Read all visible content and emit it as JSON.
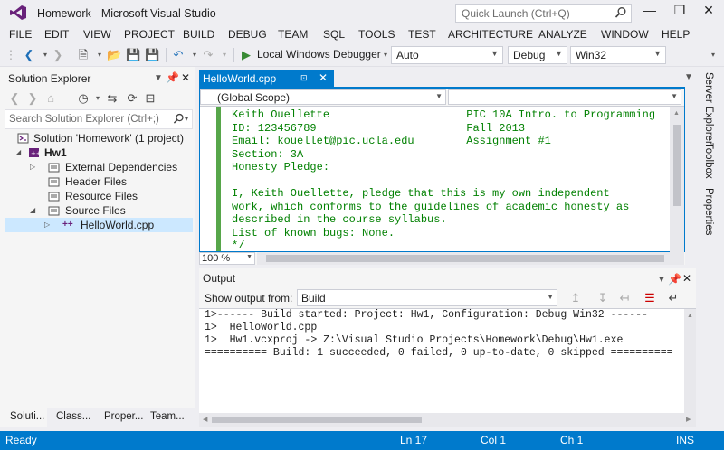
{
  "window": {
    "title": "Homework - Microsoft Visual Studio"
  },
  "quick_launch": {
    "placeholder": "Quick Launch (Ctrl+Q)"
  },
  "menu": [
    "FILE",
    "EDIT",
    "VIEW",
    "PROJECT",
    "BUILD",
    "DEBUG",
    "TEAM",
    "SQL",
    "TOOLS",
    "TEST",
    "ARCHITECTURE",
    "ANALYZE",
    "WINDOW",
    "HELP"
  ],
  "toolbar": {
    "debugger_label": "Local Windows Debugger",
    "config_auto": "Auto",
    "config_mode": "Debug",
    "platform": "Win32"
  },
  "solution_explorer": {
    "title": "Solution Explorer",
    "search_placeholder": "Search Solution Explorer (Ctrl+;)",
    "tree": [
      {
        "label": "Solution 'Homework' (1 project)",
        "icon": "solution-icon"
      },
      {
        "label": "Hw1",
        "icon": "project-icon",
        "bold": true
      },
      {
        "label": "External Dependencies",
        "icon": "folder-icon"
      },
      {
        "label": "Header Files",
        "icon": "folder-icon"
      },
      {
        "label": "Resource Files",
        "icon": "folder-icon"
      },
      {
        "label": "Source Files",
        "icon": "folder-icon"
      },
      {
        "label": "HelloWorld.cpp",
        "icon": "cpp-file-icon",
        "selected": true
      }
    ],
    "bottom_tabs": [
      "Soluti...",
      "Class...",
      "Proper...",
      "Team..."
    ]
  },
  "editor": {
    "tab_label": "HelloWorld.cpp",
    "scope": "(Global Scope)",
    "zoom": "100 %",
    "code_lines": [
      "Keith Ouellette                     PIC 10A Intro. to Programming",
      "ID: 123456789                       Fall 2013",
      "Email: kouellet@pic.ucla.edu        Assignment #1",
      "Section: 3A",
      "Honesty Pledge:",
      "",
      "I, Keith Ouellette, pledge that this is my own independent",
      "work, which conforms to the guidelines of academic honesty as",
      "described in the course syllabus.",
      "List of known bugs: None.",
      "*/"
    ]
  },
  "output": {
    "title": "Output",
    "show_from_label": "Show output from:",
    "source": "Build",
    "lines": [
      "1>------ Build started: Project: Hw1, Configuration: Debug Win32 ------",
      "1>  HelloWorld.cpp",
      "1>  Hw1.vcxproj -> Z:\\Visual Studio Projects\\Homework\\Debug\\Hw1.exe",
      "========== Build: 1 succeeded, 0 failed, 0 up-to-date, 0 skipped =========="
    ]
  },
  "side_rail": [
    "Server Explorer",
    "Toolbox",
    "Properties"
  ],
  "status": {
    "ready": "Ready",
    "line": "Ln 17",
    "col": "Col 1",
    "ch": "Ch 1",
    "mode": "INS"
  },
  "colors": {
    "accent": "#007acc",
    "code_comment": "#008000",
    "change_bar": "#57a64a"
  }
}
